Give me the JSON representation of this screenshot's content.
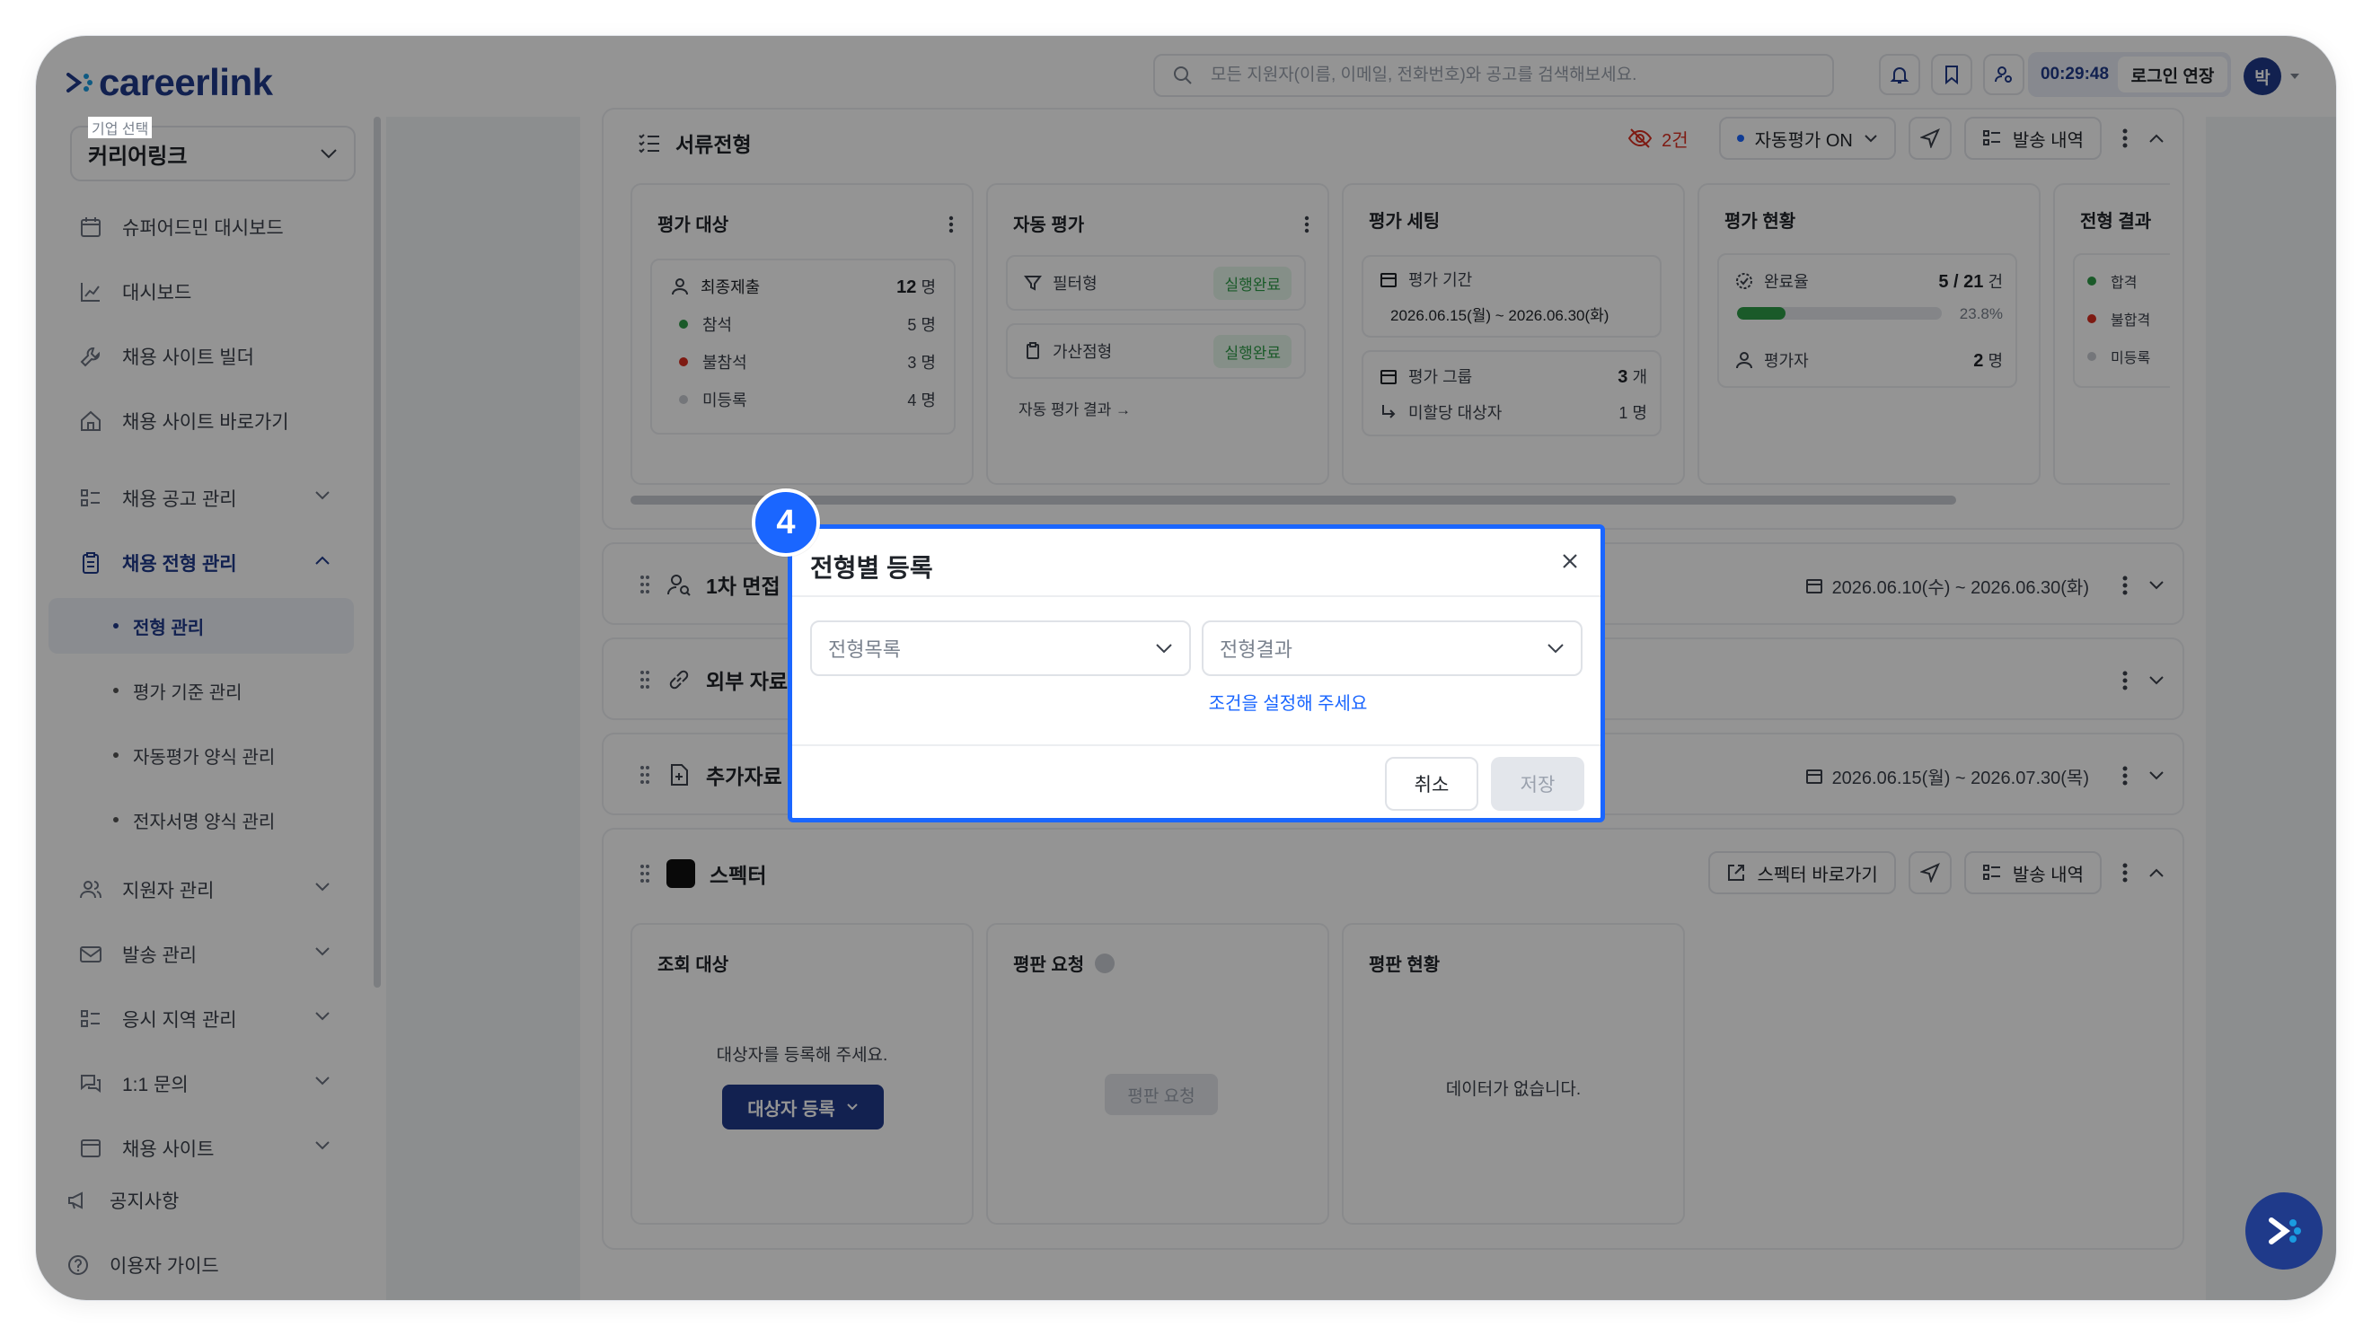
{
  "header": {
    "logo_text": "careerlink",
    "search_placeholder": "모든 지원자(이름, 이메일, 전화번호)와 공고를 검색해보세요.",
    "timer": "00:29:48",
    "extend_label": "로그인 연장",
    "avatar_initial": "박"
  },
  "sidebar": {
    "company_label": "기업 선택",
    "company_value": "커리어링크",
    "items": [
      {
        "label": "슈퍼어드민 대시보드",
        "icon": "calendar-icon"
      },
      {
        "label": "대시보드",
        "icon": "chart-icon"
      },
      {
        "label": "채용 사이트 빌더",
        "icon": "tool-icon"
      },
      {
        "label": "채용 사이트 바로가기",
        "icon": "home-icon"
      },
      {
        "label": "채용 공고 관리",
        "icon": "list-icon"
      },
      {
        "label": "채용 전형 관리",
        "icon": "clipboard-icon"
      },
      {
        "label": "지원자 관리",
        "icon": "users-icon"
      },
      {
        "label": "발송 관리",
        "icon": "mail-icon"
      },
      {
        "label": "응시 지역 관리",
        "icon": "list-icon"
      },
      {
        "label": "1:1 문의",
        "icon": "chat-icon"
      },
      {
        "label": "채용 사이트",
        "icon": "window-icon"
      }
    ],
    "subitems": [
      "전형 관리",
      "평가 기준 관리",
      "자동평가 양식 관리",
      "전자서명 양식 관리"
    ],
    "footer": [
      {
        "label": "공지사항",
        "icon": "megaphone-icon"
      },
      {
        "label": "이용자 가이드",
        "icon": "help-icon"
      }
    ]
  },
  "stage1": {
    "title": "서류전형",
    "hidden_count": "2건",
    "auto_eval": "자동평가 ON",
    "send_history": "발송 내역",
    "cards": {
      "target": {
        "title": "평가 대상",
        "total_label": "최종제출",
        "total_value": "12",
        "unit": "명",
        "rows": [
          {
            "label": "참석",
            "value": "5 명",
            "color": "#2e9b48"
          },
          {
            "label": "불참석",
            "value": "3 명",
            "color": "#d92d20"
          },
          {
            "label": "미등록",
            "value": "4 명",
            "color": "#c8ccd2"
          }
        ]
      },
      "auto": {
        "title": "자동 평가",
        "rows": [
          {
            "label": "필터형",
            "badge": "실행완료"
          },
          {
            "label": "가산점형",
            "badge": "실행완료"
          }
        ],
        "link": "자동 평가 결과 →"
      },
      "setting": {
        "title": "평가 세팅",
        "period_label": "평가 기간",
        "period_value": "2026.06.15(월) ~ 2026.06.30(화)",
        "group_label": "평가 그룹",
        "group_value": "3",
        "group_unit": "개",
        "unassigned_label": "미할당 대상자",
        "unassigned_value": "1 명"
      },
      "status": {
        "title": "평가 현황",
        "completion_label": "완료율",
        "completion_value": "5 / 21",
        "completion_unit": "건",
        "progress_percent": "23.8%",
        "progress_fraction": 0.238,
        "evaluator_label": "평가자",
        "evaluator_value": "2",
        "evaluator_unit": "명"
      },
      "result": {
        "title": "전형 결과",
        "rows": [
          {
            "label": "합격",
            "color": "#2e9b48"
          },
          {
            "label": "불합격",
            "color": "#d92d20"
          },
          {
            "label": "미등록",
            "color": "#c8ccd2"
          }
        ]
      }
    }
  },
  "stage2": {
    "title": "1차 면접",
    "date": "2026.06.10(수) ~ 2026.06.30(화)"
  },
  "stage3": {
    "title": "외부 자료 연동"
  },
  "stage4": {
    "title": "추가자료 제출",
    "date": "2026.06.15(월) ~ 2026.07.30(목)"
  },
  "stage5": {
    "title": "스펙터",
    "shortcut": "스펙터 바로가기",
    "send_history": "발송 내역",
    "cards": {
      "target": {
        "title": "조회 대상",
        "empty": "대상자를 등록해 주세요.",
        "button": "대상자 등록"
      },
      "request": {
        "title": "평판 요청",
        "button": "평판 요청"
      },
      "status": {
        "title": "평판 현황",
        "empty": "데이터가 없습니다."
      }
    }
  },
  "modal": {
    "step": "4",
    "title": "전형별 등록",
    "select1_placeholder": "전형목록",
    "select2_placeholder": "전형결과",
    "hint": "조건을 설정해 주세요",
    "cancel": "취소",
    "save": "저장"
  },
  "colors": {
    "accent": "#1a66ff",
    "brand": "#1f3a8a",
    "success": "#2e9b48",
    "danger": "#d92d20"
  }
}
